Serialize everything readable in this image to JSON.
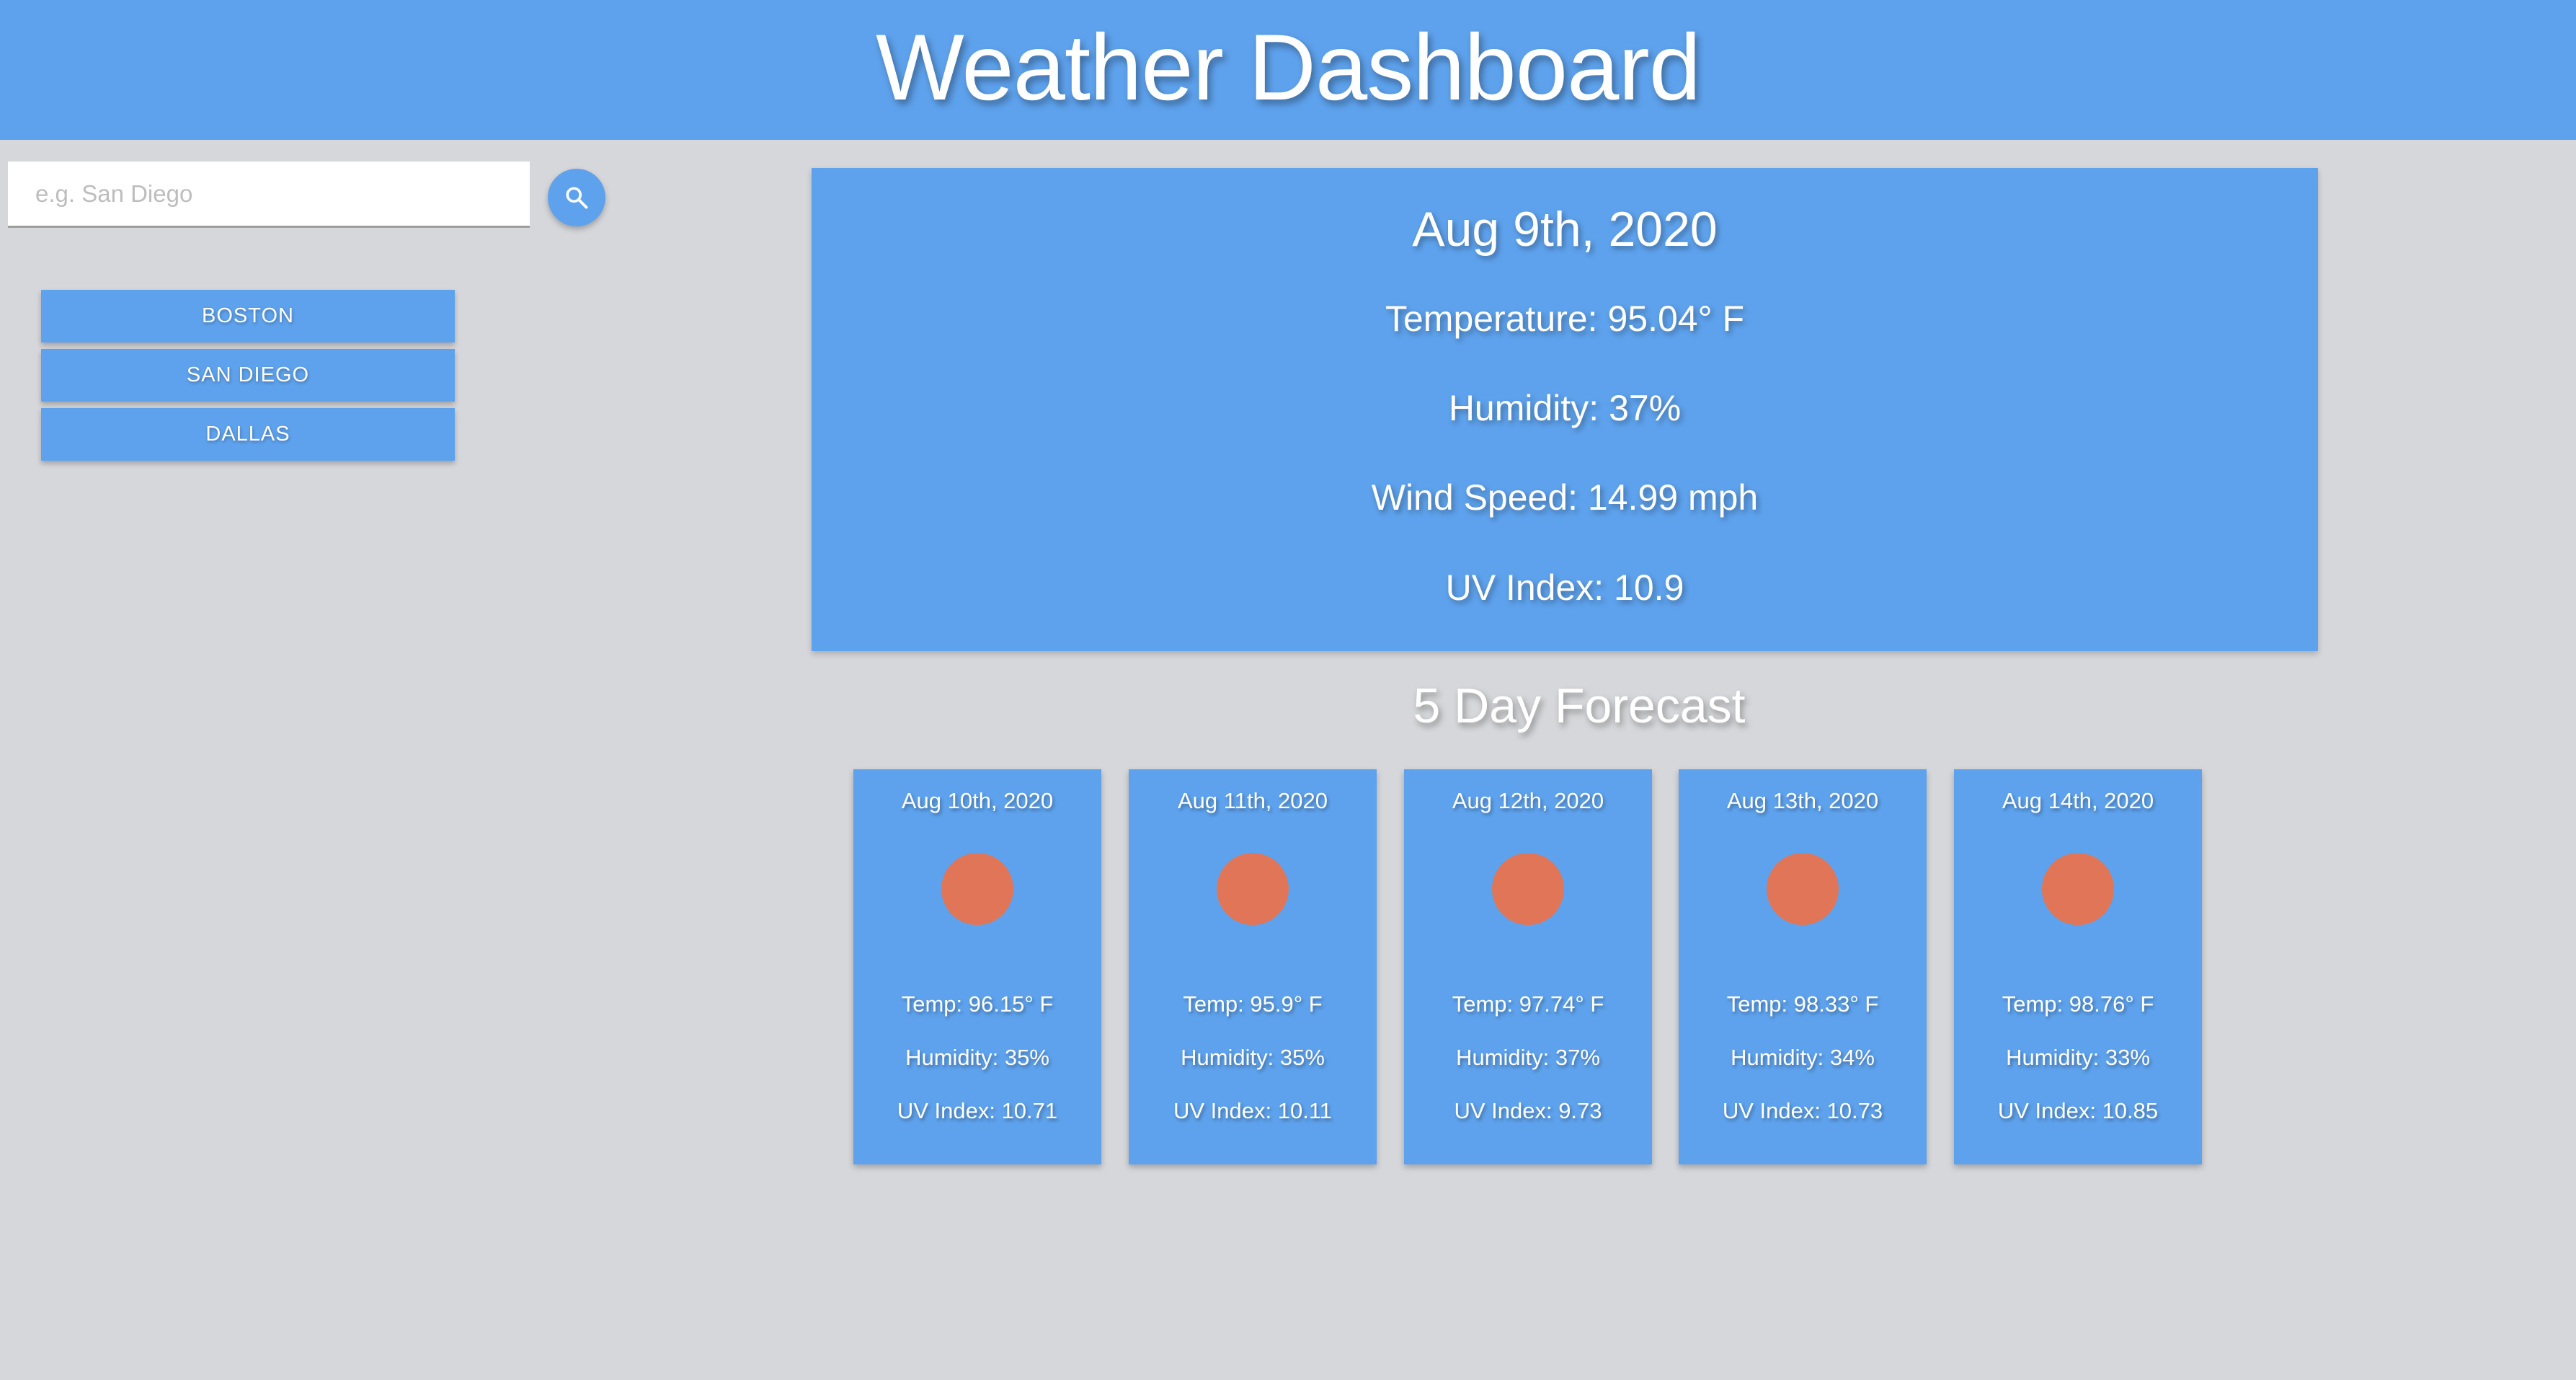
{
  "header": {
    "title": "Weather Dashboard"
  },
  "search": {
    "placeholder": "e.g. San Diego",
    "value": "",
    "button_icon": "search-icon"
  },
  "history": [
    "BOSTON",
    "SAN DIEGO",
    "DALLAS"
  ],
  "current": {
    "date": "Aug 9th, 2020",
    "temperature": "Temperature: 95.04° F",
    "humidity": "Humidity: 37%",
    "wind": "Wind Speed: 14.99 mph",
    "uv": "UV Index: 10.9"
  },
  "forecast": {
    "title": "5 Day Forecast",
    "days": [
      {
        "date": "Aug 10th, 2020",
        "icon": "sun-icon",
        "temp": "Temp: 96.15° F",
        "humidity": "Humidity: 35%",
        "uv": "UV Index: 10.71"
      },
      {
        "date": "Aug 11th, 2020",
        "icon": "sun-icon",
        "temp": "Temp: 95.9° F",
        "humidity": "Humidity: 35%",
        "uv": "UV Index: 10.11"
      },
      {
        "date": "Aug 12th, 2020",
        "icon": "sun-icon",
        "temp": "Temp: 97.74° F",
        "humidity": "Humidity: 37%",
        "uv": "UV Index: 9.73"
      },
      {
        "date": "Aug 13th, 2020",
        "icon": "sun-icon",
        "temp": "Temp: 98.33° F",
        "humidity": "Humidity: 34%",
        "uv": "UV Index: 10.73"
      },
      {
        "date": "Aug 14th, 2020",
        "icon": "sun-icon",
        "temp": "Temp: 98.76° F",
        "humidity": "Humidity: 33%",
        "uv": "UV Index: 10.85"
      }
    ]
  },
  "colors": {
    "accent": "#5ea2ed",
    "background": "#d6d7da",
    "sun": "#e07657"
  }
}
